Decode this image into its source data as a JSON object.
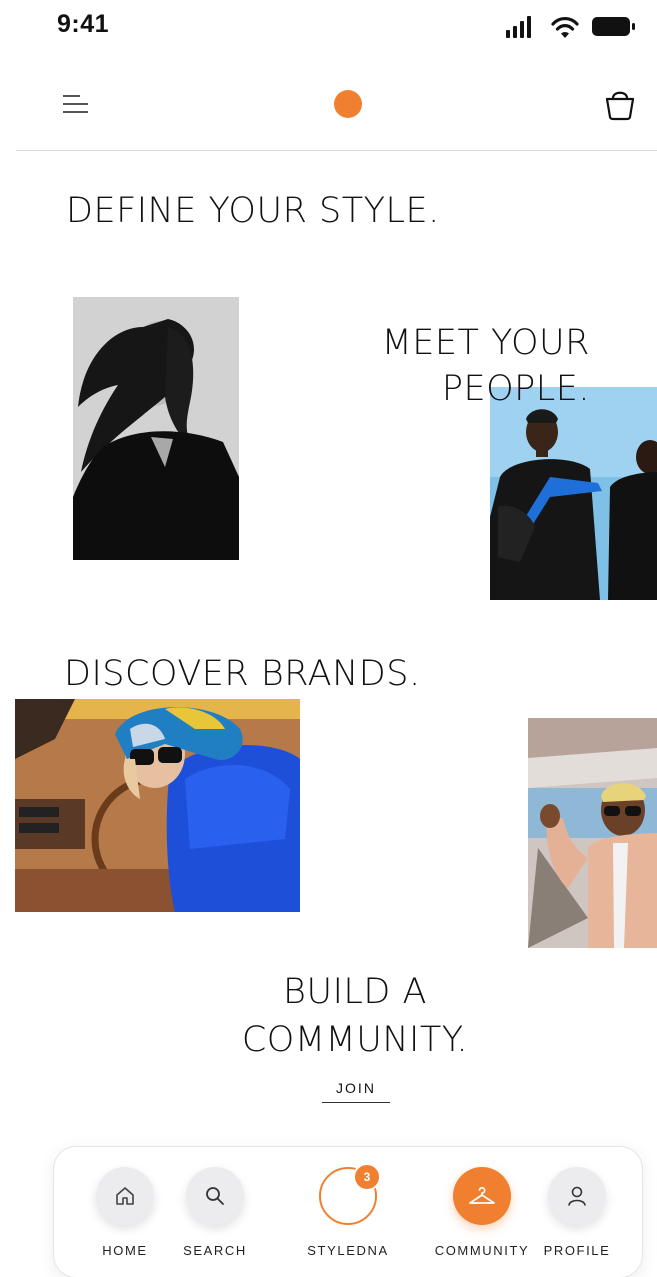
{
  "status_bar": {
    "time": "9:41",
    "icons": [
      "signal-icon",
      "wifi-icon",
      "battery-icon"
    ]
  },
  "header": {
    "menu_icon": "menu-icon",
    "logo_color": "#f0802f",
    "cart_icon": "shopping-bag-icon"
  },
  "sections": {
    "define": "DEFINE YOUR STYLE.",
    "meet": "MEET YOUR PEOPLE.",
    "discover": "DISCOVER BRANDS.",
    "build": "BUILD A COMMUNITY."
  },
  "join_label": "JOIN",
  "bottom_nav": {
    "items": [
      {
        "label": "HOME",
        "icon": "home-icon"
      },
      {
        "label": "SEARCH",
        "icon": "search-icon"
      },
      {
        "label": "STYLEDNA",
        "icon": "styledna-ring-icon",
        "badge": "3"
      },
      {
        "label": "COMMUNITY",
        "icon": "hanger-icon",
        "active": true
      },
      {
        "label": "PROFILE",
        "icon": "user-icon"
      }
    ]
  },
  "colors": {
    "accent": "#f0802f",
    "text": "#111111",
    "background": "#ffffff"
  }
}
